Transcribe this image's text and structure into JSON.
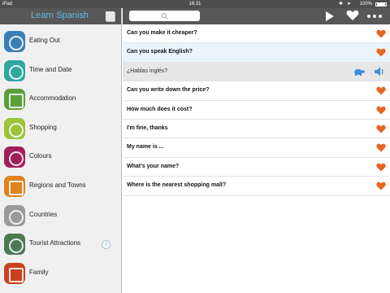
{
  "status_bar": {
    "carrier": "iPad",
    "time": "16:31",
    "battery": "100%"
  },
  "sidebar": {
    "title": "Learn Spanish",
    "items": [
      {
        "label": "Eating Out",
        "color": "#3a7fb5",
        "icon": "plate-icon"
      },
      {
        "label": "Time and Date",
        "color": "#2fa79d",
        "icon": "clock-icon"
      },
      {
        "label": "Accommodation",
        "color": "#5a9f3b",
        "icon": "bed-icon"
      },
      {
        "label": "Shopping",
        "color": "#9cc43a",
        "icon": "bag-icon"
      },
      {
        "label": "Colours",
        "color": "#a0205a",
        "icon": "palette-icon"
      },
      {
        "label": "Regions and Towns",
        "color": "#e0821f",
        "icon": "buildings-icon"
      },
      {
        "label": "Countries",
        "color": "#9a9a9a",
        "icon": "globe-icon"
      },
      {
        "label": "Tourist Attractions",
        "color": "#4b7a52",
        "icon": "camera-icon",
        "info": "i"
      },
      {
        "label": "Family",
        "color": "#c8421e",
        "icon": "family-photo-icon"
      }
    ]
  },
  "main": {
    "phrases": [
      {
        "text": "Can you make it cheaper?",
        "type": "phrase"
      },
      {
        "text": "Can you speak English?",
        "type": "selected"
      },
      {
        "text": "¿Hablas inglés?",
        "type": "translation"
      },
      {
        "text": "Can you write down the price?",
        "type": "phrase"
      },
      {
        "text": "How much does it cost?",
        "type": "phrase"
      },
      {
        "text": "I'm fine, thanks",
        "type": "phrase"
      },
      {
        "text": "My name is ...",
        "type": "phrase"
      },
      {
        "text": "What's your name?",
        "type": "phrase"
      },
      {
        "text": "Where is the nearest shopping mall?",
        "type": "phrase"
      }
    ],
    "heart_color": "#e8641f",
    "accent_color": "#3a8fd8"
  }
}
